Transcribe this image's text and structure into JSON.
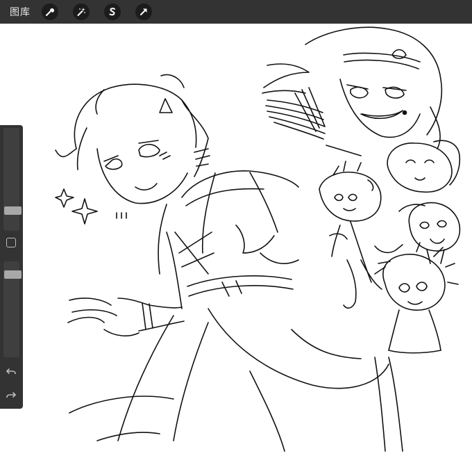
{
  "toolbar": {
    "gallery_label": "图库",
    "tools": [
      {
        "icon": "wrench-icon",
        "name": "actions"
      },
      {
        "icon": "magic-wand-icon",
        "name": "adjustments"
      },
      {
        "icon": "selection-s-icon",
        "name": "selection"
      },
      {
        "icon": "arrow-cursor-icon",
        "name": "transform"
      }
    ]
  },
  "sidebar": {
    "brush_size": 0.17,
    "brush_opacity": 0.9
  },
  "colors": {
    "toolbar_bg": "#333333",
    "tool_button_bg": "#1c1c1c",
    "sidebar_bg": "#333333",
    "slider_track": "#3f3f3f",
    "slider_thumb": "#a8a8a8",
    "canvas_bg": "#ffffff",
    "ink": "#111111"
  }
}
